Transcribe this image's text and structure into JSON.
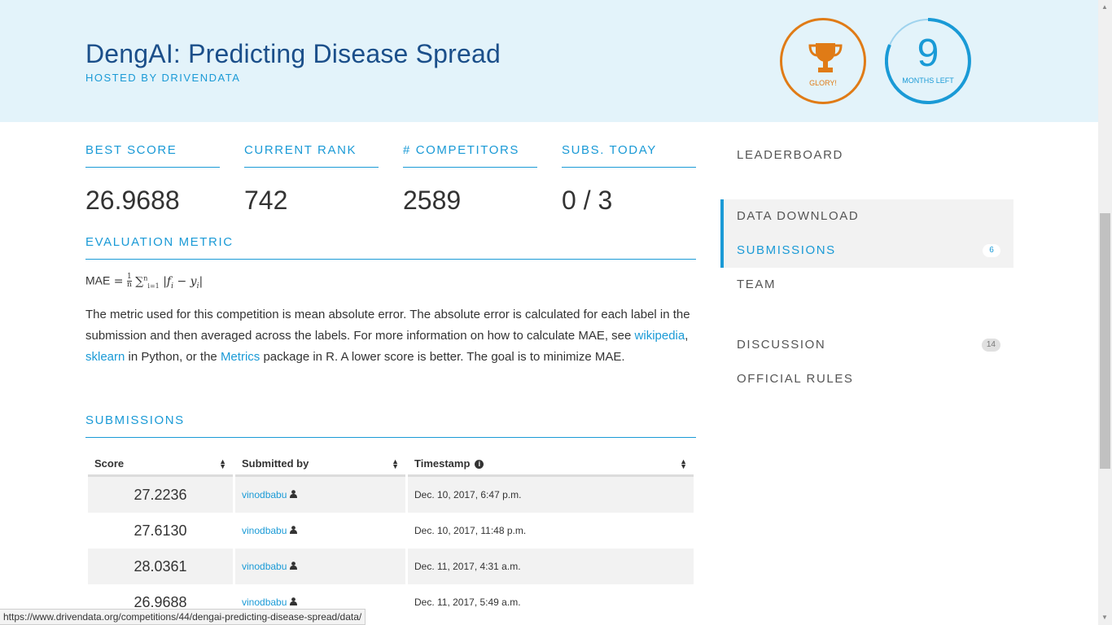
{
  "header": {
    "title": "DengAI: Predicting Disease Spread",
    "hosted_by": "HOSTED BY DRIVENDATA",
    "glory_label": "GLORY!",
    "months_value": "9",
    "months_label": "MONTHS LEFT",
    "colors": {
      "glory": "#e07b16",
      "accent": "#1a9ad6"
    }
  },
  "stats": [
    {
      "label": "BEST SCORE",
      "value": "26.9688"
    },
    {
      "label": "CURRENT RANK",
      "value": "742"
    },
    {
      "label": "# COMPETITORS",
      "value": "2589"
    },
    {
      "label": "SUBS. TODAY",
      "value": "0 / 3"
    }
  ],
  "evaluation": {
    "heading": "EVALUATION METRIC",
    "formula_prefix": "MAE",
    "description_1": "The metric used for this competition is mean absolute error. The absolute error is calculated for each label in the submission and then averaged across the labels. For more information on how to calculate MAE, see ",
    "link_wikipedia": "wikipedia",
    "sep_1": ", ",
    "link_sklearn": "sklearn",
    "description_2": " in Python, or the ",
    "link_metrics": "Metrics",
    "description_3": " package in R. A lower score is better. The goal is to minimize MAE."
  },
  "submissions": {
    "heading": "SUBMISSIONS",
    "columns": [
      "Score",
      "Submitted by",
      "Timestamp"
    ],
    "rows": [
      {
        "score": "27.2236",
        "user": "vinodbabu",
        "timestamp": "Dec. 10, 2017, 6:47 p.m."
      },
      {
        "score": "27.6130",
        "user": "vinodbabu",
        "timestamp": "Dec. 10, 2017, 11:48 p.m."
      },
      {
        "score": "28.0361",
        "user": "vinodbabu",
        "timestamp": "Dec. 11, 2017, 4:31 a.m."
      },
      {
        "score": "26.9688",
        "user": "vinodbabu",
        "timestamp": "Dec. 11, 2017, 5:49 a.m."
      }
    ]
  },
  "sidenav": {
    "leaderboard": "LEADERBOARD",
    "data_download": "DATA DOWNLOAD",
    "submissions": "SUBMISSIONS",
    "submissions_count": "6",
    "team": "TEAM",
    "discussion": "DISCUSSION",
    "discussion_count": "14",
    "official_rules": "OFFICIAL RULES"
  },
  "statusbar": {
    "url": "https://www.drivendata.org/competitions/44/dengai-predicting-disease-spread/data/"
  }
}
